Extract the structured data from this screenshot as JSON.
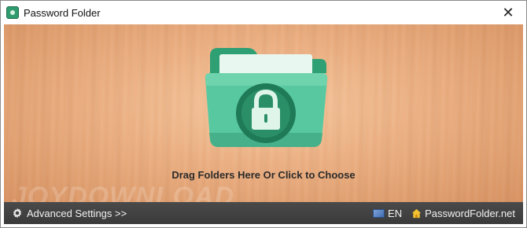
{
  "window": {
    "title": "Password Folder",
    "app_icon": "password-folder-app-icon",
    "close_glyph": "✕"
  },
  "main": {
    "drop_prompt": "Drag Folders Here Or Click to Choose",
    "folder_icon": "locked-folder-icon",
    "watermark": "JOYDOWNLOAD"
  },
  "footer": {
    "advanced_settings_label": "Advanced Settings >>",
    "language_label": "EN",
    "site_label": "PasswordFolder.net"
  },
  "colors": {
    "folder_green": "#4fc59b",
    "folder_dark": "#1f7a57",
    "footer_bg": "#404040"
  }
}
